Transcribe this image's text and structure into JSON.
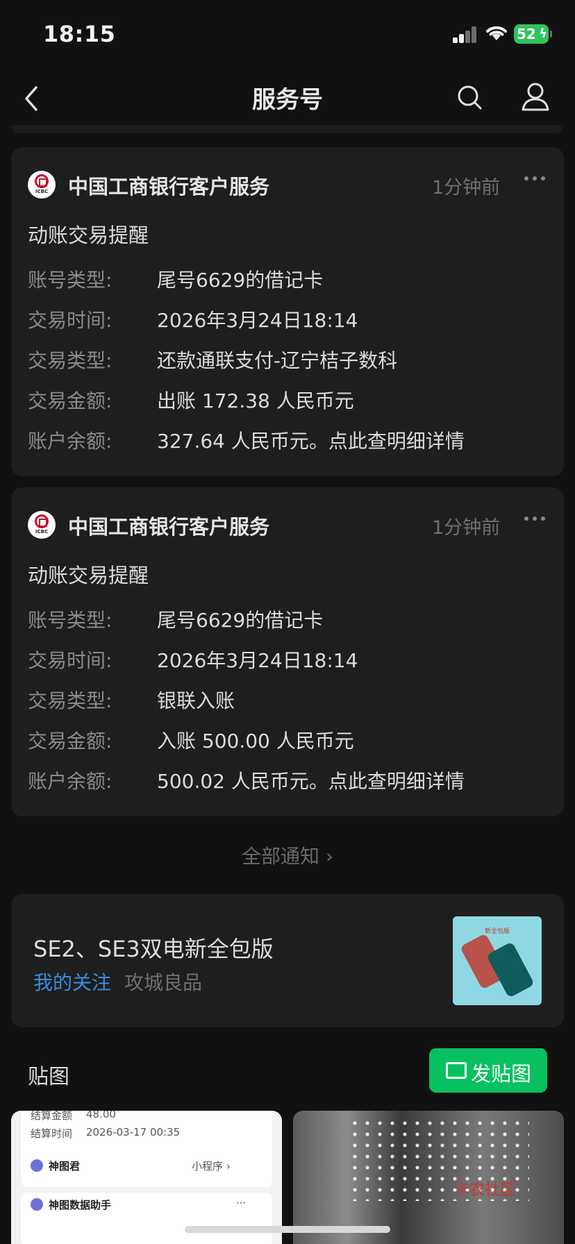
{
  "status_bar": {
    "time": "18:15",
    "battery": "52"
  },
  "nav": {
    "title": "服务号"
  },
  "notifications": [
    {
      "sender": "中国工商银行客户服务",
      "logo_text": "ICBC",
      "time_ago": "1分钟前",
      "heading": "动账交易提醒",
      "rows": [
        {
          "label": "账号类型:",
          "value": "尾号6629的借记卡"
        },
        {
          "label": "交易时间:",
          "value": "2026年3月24日18:14"
        },
        {
          "label": "交易类型:",
          "value": "还款通联支付-辽宁桔子数科"
        },
        {
          "label": "交易金额:",
          "value": "出账 172.38 人民币元"
        },
        {
          "label": "账户余额:",
          "value": "327.64 人民币元。点此查明细详情"
        }
      ]
    },
    {
      "sender": "中国工商银行客户服务",
      "logo_text": "ICBC",
      "time_ago": "1分钟前",
      "heading": "动账交易提醒",
      "rows": [
        {
          "label": "账号类型:",
          "value": "尾号6629的借记卡"
        },
        {
          "label": "交易时间:",
          "value": "2026年3月24日18:14"
        },
        {
          "label": "交易类型:",
          "value": "银联入账"
        },
        {
          "label": "交易金额:",
          "value": "入账 500.00 人民币元"
        },
        {
          "label": "账户余额:",
          "value": "500.02 人民币元。点此查明细详情"
        }
      ]
    }
  ],
  "all_notices_label": "全部通知 ›",
  "article": {
    "title": "SE2、SE3双电新全包版",
    "tag": "我的关注",
    "source": "攻城良品",
    "thumb_label": "新全包版"
  },
  "stickers": {
    "title": "贴图",
    "post_button": "发贴图"
  },
  "tile_left": {
    "line1_label": "结算金额",
    "line1_value": "48.00",
    "line2_label": "结算时间",
    "line2_value": "2026-03-17 00:35",
    "app_name": "神图君",
    "mini_program": "小程序 ›",
    "assistant_name": "神图数据助手",
    "more": "···"
  },
  "tile_right": {
    "watermark": "卡农社区"
  },
  "colors": {
    "accent_green": "#07c160",
    "link_blue": "#3b8bde",
    "icbc_red": "#c8102e"
  }
}
